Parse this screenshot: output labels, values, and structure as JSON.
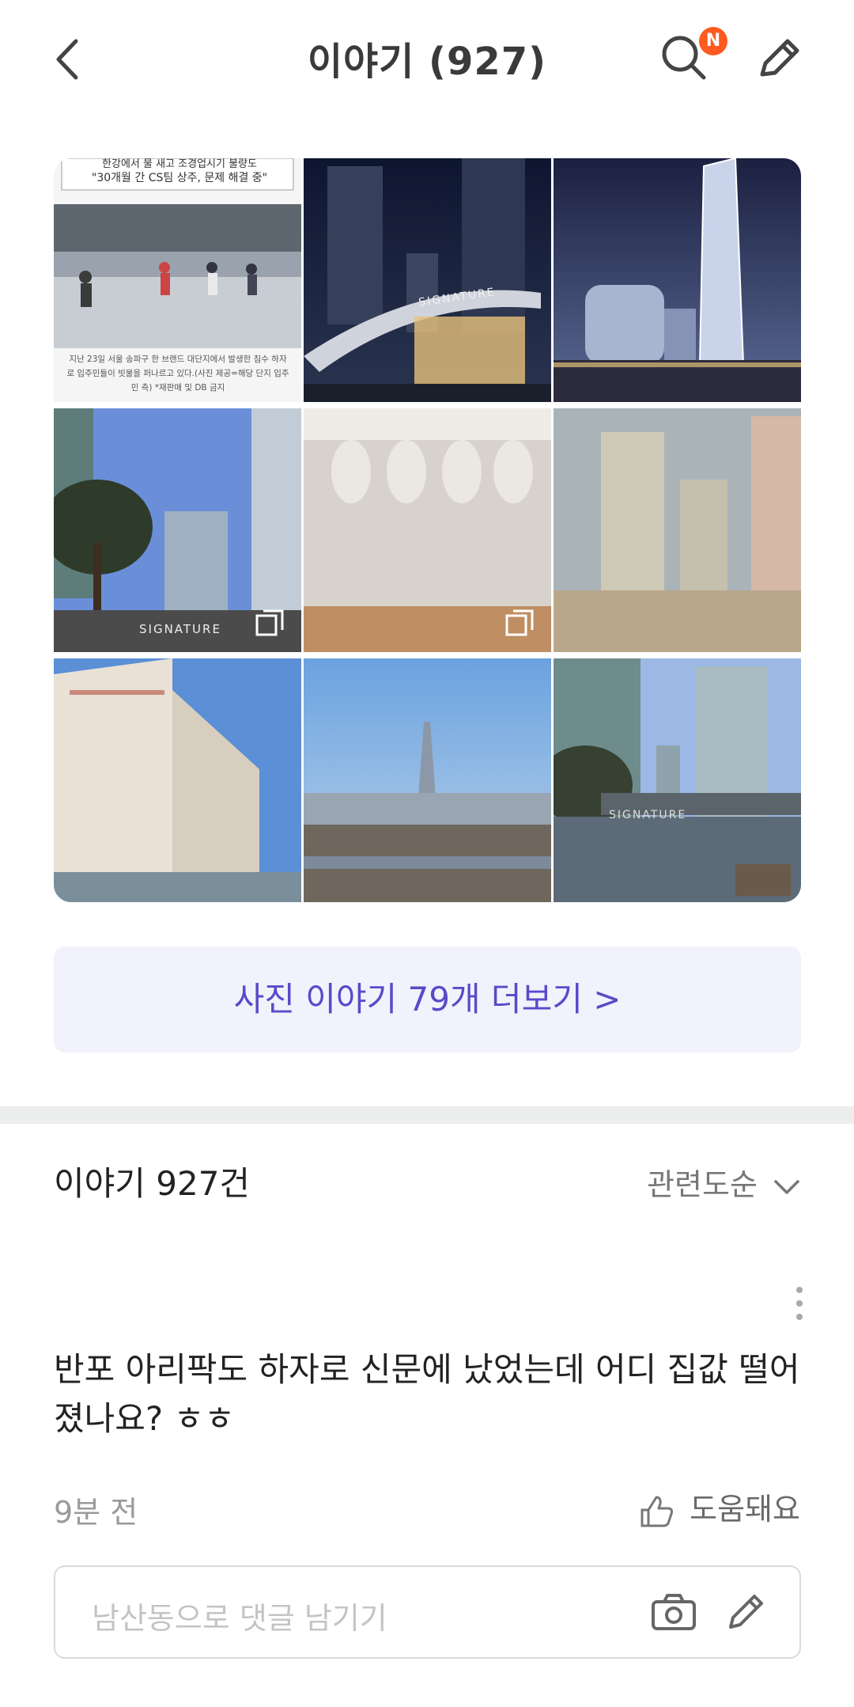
{
  "header": {
    "title": "이야기 (927)",
    "search_badge": "N",
    "icons": {
      "back": "chevron-left-icon",
      "search": "search-icon",
      "write": "pencil-icon"
    }
  },
  "photo_grid": {
    "items": [
      {
        "description_name": "news-article-photo",
        "caption_lines": [
          "한강에서 물 새고 조경업시기 불량도",
          "\"30개월 간 CS팀 상주, 문제 해결 중\""
        ],
        "footer_lines": [
          "지난 23일 서울 송파구 한 브랜드 대단지에서 발생한 침수 하자",
          "로 입주민들이 빗물을 퍼나르고 있다.(사진 제공=해당 단지 입주",
          "민 측) *재판매 및 DB 금지"
        ]
      },
      {
        "description_name": "signature-gate-night-photo",
        "sign_text": "SIGNATURE"
      },
      {
        "description_name": "tower-render-photo"
      },
      {
        "description_name": "apartment-tree-photo",
        "sign_text": "SIGNATURE",
        "multi": true
      },
      {
        "description_name": "empty-room-photo",
        "multi": true
      },
      {
        "description_name": "apartment-window-photo"
      },
      {
        "description_name": "apartment-facade-photo"
      },
      {
        "description_name": "city-skyline-photo"
      },
      {
        "description_name": "apartment-gate-day-photo",
        "sign_text": "SIGNATURE"
      }
    ]
  },
  "more_button": {
    "label": "사진 이야기 79개 더보기 >"
  },
  "list": {
    "count_label": "이야기 927건",
    "sort_label": "관련도순"
  },
  "post": {
    "text": "반포 아리팍도 하자로  신문에 났었는데 어디 집값 떨어졌나요? ㅎㅎ",
    "time": "9분 전",
    "helpful_label": "도움돼요"
  },
  "comment": {
    "placeholder": "남산동으로 댓글 남기기"
  },
  "colors": {
    "accent": "#5b49c9",
    "badge": "#ff5a1f",
    "more_bg": "#f1f2fb"
  }
}
